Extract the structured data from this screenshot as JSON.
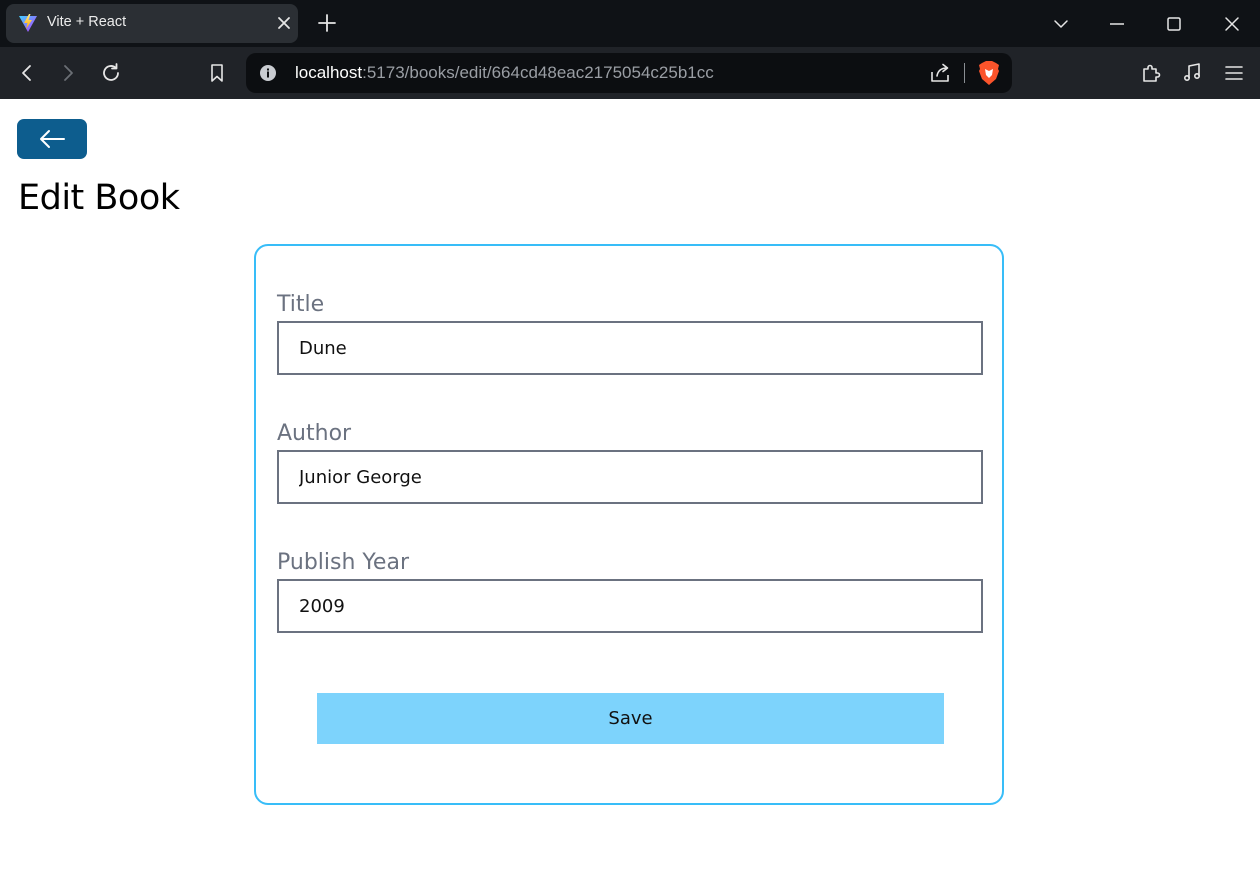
{
  "browser": {
    "tab": {
      "title": "Vite + React",
      "favicon": "vite-icon"
    },
    "address": {
      "host": "localhost",
      "rest": ":5173/books/edit/664cd48eac2175054c25b1cc"
    },
    "icons": {
      "back": "arrow-left-icon",
      "forward": "arrow-right-icon",
      "reload": "reload-icon",
      "bookmark": "bookmark-icon",
      "share": "share-icon",
      "brave": "brave-shield-icon",
      "extensions": "puzzle-icon",
      "media": "music-note-icon",
      "menu": "hamburger-icon"
    }
  },
  "page": {
    "title": "Edit Book",
    "back_button_icon": "arrow-left-icon",
    "accent_color": "#38bdf8",
    "button_color": "#7dd3fc",
    "back_button_color": "#0d5d8e"
  },
  "form": {
    "fields": [
      {
        "label": "Title",
        "value": "Dune"
      },
      {
        "label": "Author",
        "value": "Junior George"
      },
      {
        "label": "Publish Year",
        "value": "2009"
      }
    ],
    "save_label": "Save"
  }
}
